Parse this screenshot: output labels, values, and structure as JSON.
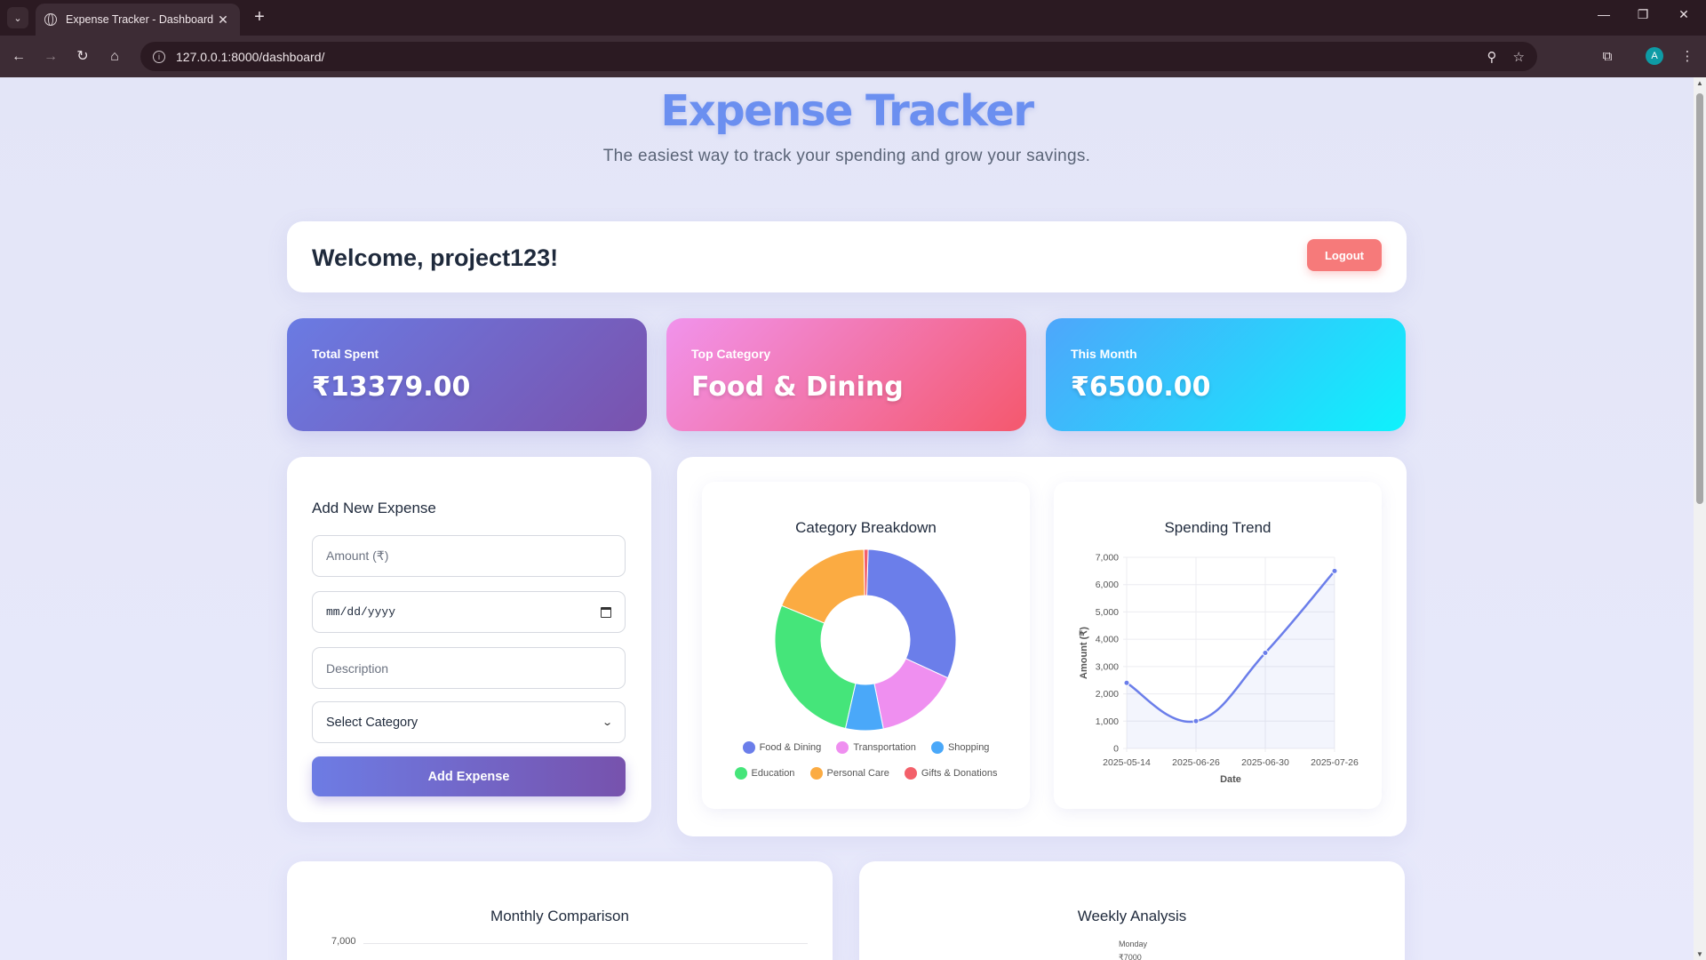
{
  "browser": {
    "tab_title": "Expense Tracker - Dashboard",
    "url": "127.0.0.1:8000/dashboard/",
    "profile_initial": "A"
  },
  "header": {
    "title": "Expense Tracker",
    "subtitle": "The easiest way to track your spending and grow your savings."
  },
  "welcome": {
    "text": "Welcome, project123!",
    "logout_label": "Logout"
  },
  "stats": [
    {
      "label": "Total Spent",
      "value": "₹13379.00"
    },
    {
      "label": "Top Category",
      "value": "Food & Dining"
    },
    {
      "label": "This Month",
      "value": "₹6500.00"
    }
  ],
  "form": {
    "title": "Add New Expense",
    "amount_placeholder": "Amount (₹)",
    "date_placeholder": "mm/dd/yyyy",
    "description_placeholder": "Description",
    "category_selected": "Select Category",
    "submit_label": "Add Expense"
  },
  "colors": {
    "food": "#6b7eea",
    "transport": "#ef8ff0",
    "shopping": "#4aa8f9",
    "education": "#45e57a",
    "personal": "#fbab42",
    "gifts": "#f3606a",
    "line": "#6b7eea"
  },
  "chart_data": [
    {
      "type": "pie",
      "title": "Category Breakdown",
      "categories": [
        "Food & Dining",
        "Transportation",
        "Shopping",
        "Education",
        "Personal Care",
        "Gifts & Donations"
      ],
      "values": [
        4200,
        2000,
        900,
        3700,
        2479,
        100
      ]
    },
    {
      "type": "line",
      "title": "Spending Trend",
      "xlabel": "Date",
      "ylabel": "Amount (₹)",
      "x": [
        "2025-05-14",
        "2025-06-26",
        "2025-06-30",
        "2025-07-26"
      ],
      "values": [
        2400,
        1000,
        3500,
        6500
      ],
      "ylim": [
        0,
        7000
      ],
      "yticks": [
        "0",
        "1,000",
        "2,000",
        "3,000",
        "4,000",
        "5,000",
        "6,000",
        "7,000"
      ],
      "grid": true
    },
    {
      "type": "bar",
      "title": "Monthly Comparison",
      "yticks": [
        "7,000"
      ]
    },
    {
      "type": "bar",
      "title": "Weekly Analysis",
      "labels": [
        "Monday",
        "₹7000"
      ]
    }
  ]
}
